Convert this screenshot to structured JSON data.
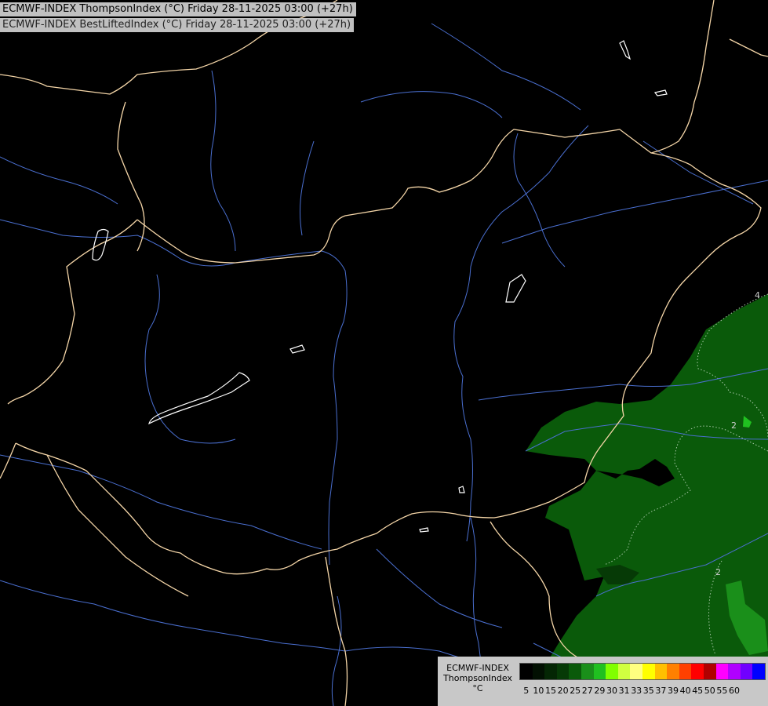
{
  "header": {
    "line1": "ECMWF-INDEX ThompsonIndex (°C) Friday 28-11-2025 03:00 (+27h)",
    "line2": "ECMWF-INDEX BestLiftedIndex (°C) Friday 28-11-2025 03:00 (+27h)"
  },
  "legend": {
    "title_line1": "ECMWF-INDEX",
    "title_line2": "ThompsonIndex",
    "unit": "°C",
    "classes": [
      {
        "label": "5",
        "color": "#000000"
      },
      {
        "label": "10",
        "color": "#021002"
      },
      {
        "label": "15",
        "color": "#042604"
      },
      {
        "label": "20",
        "color": "#063a06"
      },
      {
        "label": "25",
        "color": "#0a5a0a"
      },
      {
        "label": "27",
        "color": "#1a8f1a"
      },
      {
        "label": "29",
        "color": "#20c020"
      },
      {
        "label": "30",
        "color": "#80ff00"
      },
      {
        "label": "31",
        "color": "#d0ff40"
      },
      {
        "label": "33",
        "color": "#ffff80"
      },
      {
        "label": "35",
        "color": "#ffff00"
      },
      {
        "label": "37",
        "color": "#ffc000"
      },
      {
        "label": "39",
        "color": "#ff8000"
      },
      {
        "label": "40",
        "color": "#ff4000"
      },
      {
        "label": "45",
        "color": "#ff0000"
      },
      {
        "label": "50",
        "color": "#b00000"
      },
      {
        "label": "55",
        "color": "#ff00ff"
      },
      {
        "label": "60",
        "color": "#b000ff"
      },
      {
        "label": "",
        "color": "#7000ff"
      },
      {
        "label": "",
        "color": "#0000ff"
      }
    ]
  },
  "map": {
    "contour_labels": [
      "4",
      "2",
      "2"
    ],
    "colors": {
      "border": "#f5d6a8",
      "river": "#4a6fd0",
      "lake": "#ffffff",
      "fill_low": "#063a06",
      "fill_mid": "#0a5a0a",
      "fill_high": "#1a8f1a",
      "contour": "#a8c8a8"
    }
  }
}
